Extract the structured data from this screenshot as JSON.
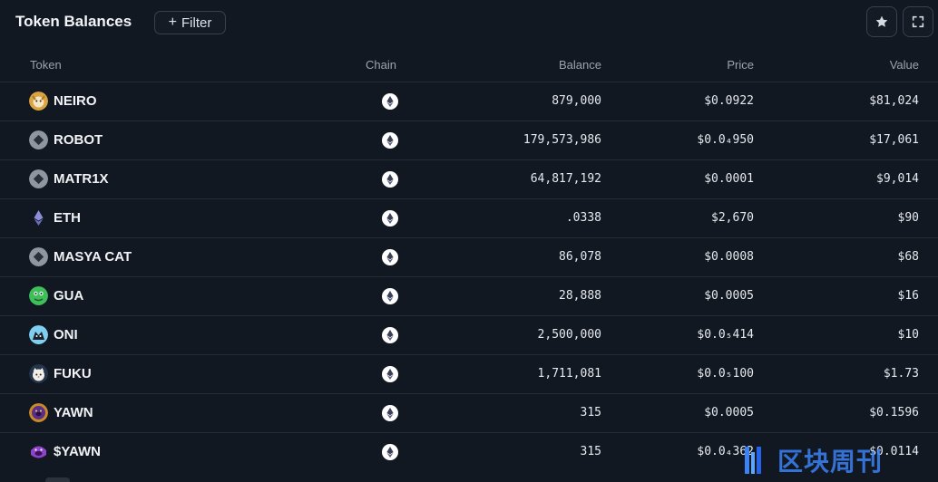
{
  "header": {
    "title": "Token Balances",
    "filter_label": "Filter",
    "star_icon": "star-icon",
    "fullscreen_icon": "fullscreen-icon"
  },
  "columns": {
    "token": "Token",
    "chain": "Chain",
    "balance": "Balance",
    "price": "Price",
    "value": "Value"
  },
  "rows": [
    {
      "name": "NEIRO",
      "icon": "neiro-token-icon",
      "chain": "ethereum-icon",
      "balance": "879,000",
      "price": "$0.0922",
      "value": "$81,024"
    },
    {
      "name": "ROBOT",
      "icon": "generic-token-icon",
      "chain": "ethereum-icon",
      "balance": "179,573,986",
      "price": "$0.0₄950",
      "value": "$17,061"
    },
    {
      "name": "MATR1X",
      "icon": "generic-token-icon",
      "chain": "ethereum-icon",
      "balance": "64,817,192",
      "price": "$0.0001",
      "value": "$9,014"
    },
    {
      "name": "ETH",
      "icon": "eth-token-icon",
      "chain": "ethereum-icon",
      "balance": ".0338",
      "price": "$2,670",
      "value": "$90"
    },
    {
      "name": "MASYA CAT",
      "icon": "generic-token-icon",
      "chain": "ethereum-icon",
      "balance": "86,078",
      "price": "$0.0008",
      "value": "$68"
    },
    {
      "name": "GUA",
      "icon": "gua-token-icon",
      "chain": "ethereum-icon",
      "balance": "28,888",
      "price": "$0.0005",
      "value": "$16"
    },
    {
      "name": "ONI",
      "icon": "oni-token-icon",
      "chain": "ethereum-icon",
      "balance": "2,500,000",
      "price": "$0.0₅414",
      "value": "$10"
    },
    {
      "name": "FUKU",
      "icon": "fuku-token-icon",
      "chain": "ethereum-icon",
      "balance": "1,711,081",
      "price": "$0.0₅100",
      "value": "$1.73"
    },
    {
      "name": "YAWN",
      "icon": "yawn-token-icon",
      "chain": "ethereum-icon",
      "balance": "315",
      "price": "$0.0005",
      "value": "$0.1596"
    },
    {
      "name": "$YAWN",
      "icon": "dollar-yawn-token-icon",
      "chain": "ethereum-icon",
      "balance": "315",
      "price": "$0.0₄362",
      "value": "$0.0114"
    }
  ],
  "watermark": {
    "text": "区块周刊"
  },
  "colors": {
    "background": "#121821",
    "row_border": "#262d38",
    "muted_text": "#9aa3ae",
    "accent": "#3b82f6"
  }
}
